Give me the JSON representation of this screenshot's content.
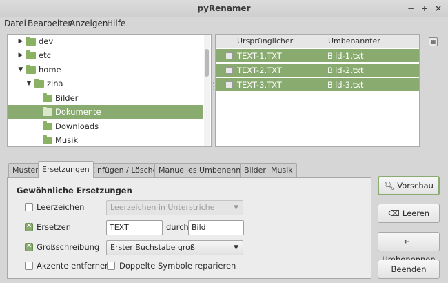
{
  "window": {
    "title": "pyRenamer",
    "controls": {
      "minimize": "−",
      "maximize": "+",
      "close": "×"
    }
  },
  "menu": [
    "Datei",
    "Bearbeiten",
    "Anzeigen",
    "Hilfe"
  ],
  "tree": {
    "items": [
      {
        "label": "dev",
        "expander": "▶"
      },
      {
        "label": "etc",
        "expander": "▶"
      },
      {
        "label": "home",
        "expander": "▼"
      },
      {
        "label": "zina",
        "expander": "▼"
      },
      {
        "label": "Bilder",
        "expander": ""
      },
      {
        "label": "Dokumente",
        "expander": "",
        "selected": true
      },
      {
        "label": "Downloads",
        "expander": ""
      },
      {
        "label": "Musik",
        "expander": ""
      }
    ]
  },
  "files": {
    "columns": [
      "Ursprünglicher Dateiname",
      "Umbenannter Dateiname"
    ],
    "rows": [
      {
        "original": "TEXT-1.TXT",
        "renamed": "Bild-1.txt"
      },
      {
        "original": "TEXT-2.TXT",
        "renamed": "Bild-2.txt"
      },
      {
        "original": "TEXT-3.TXT",
        "renamed": "Bild-3.txt"
      }
    ]
  },
  "tabs": [
    "Muster",
    "Ersetzungen",
    "Einfügen / Löschen",
    "Manuelles Umbenennen",
    "Bilder",
    "Musik"
  ],
  "active_tab": "Ersetzungen",
  "replacements": {
    "section_title": "Gewöhnliche Ersetzungen",
    "spaces": {
      "label": "Leerzeichen",
      "checked": false,
      "combo": "Leerzeichen in Unterstriche"
    },
    "replace": {
      "label": "Ersetzen",
      "checked": true,
      "from": "TEXT",
      "by_label": "durch",
      "to": "Bild"
    },
    "case": {
      "label": "Großschreibung",
      "checked": true,
      "combo": "Erster Buchstabe groß"
    },
    "accents": {
      "label": "Akzente entfernen",
      "checked": false
    },
    "duplicates": {
      "label": "Doppelte Symbole reparieren",
      "checked": false
    }
  },
  "buttons": {
    "preview": "Vorschau",
    "clear": "Leeren",
    "rename": "Umbenennen",
    "quit": "Beenden"
  },
  "colors": {
    "selection": "#8aab70",
    "folder": "#8bb163"
  }
}
